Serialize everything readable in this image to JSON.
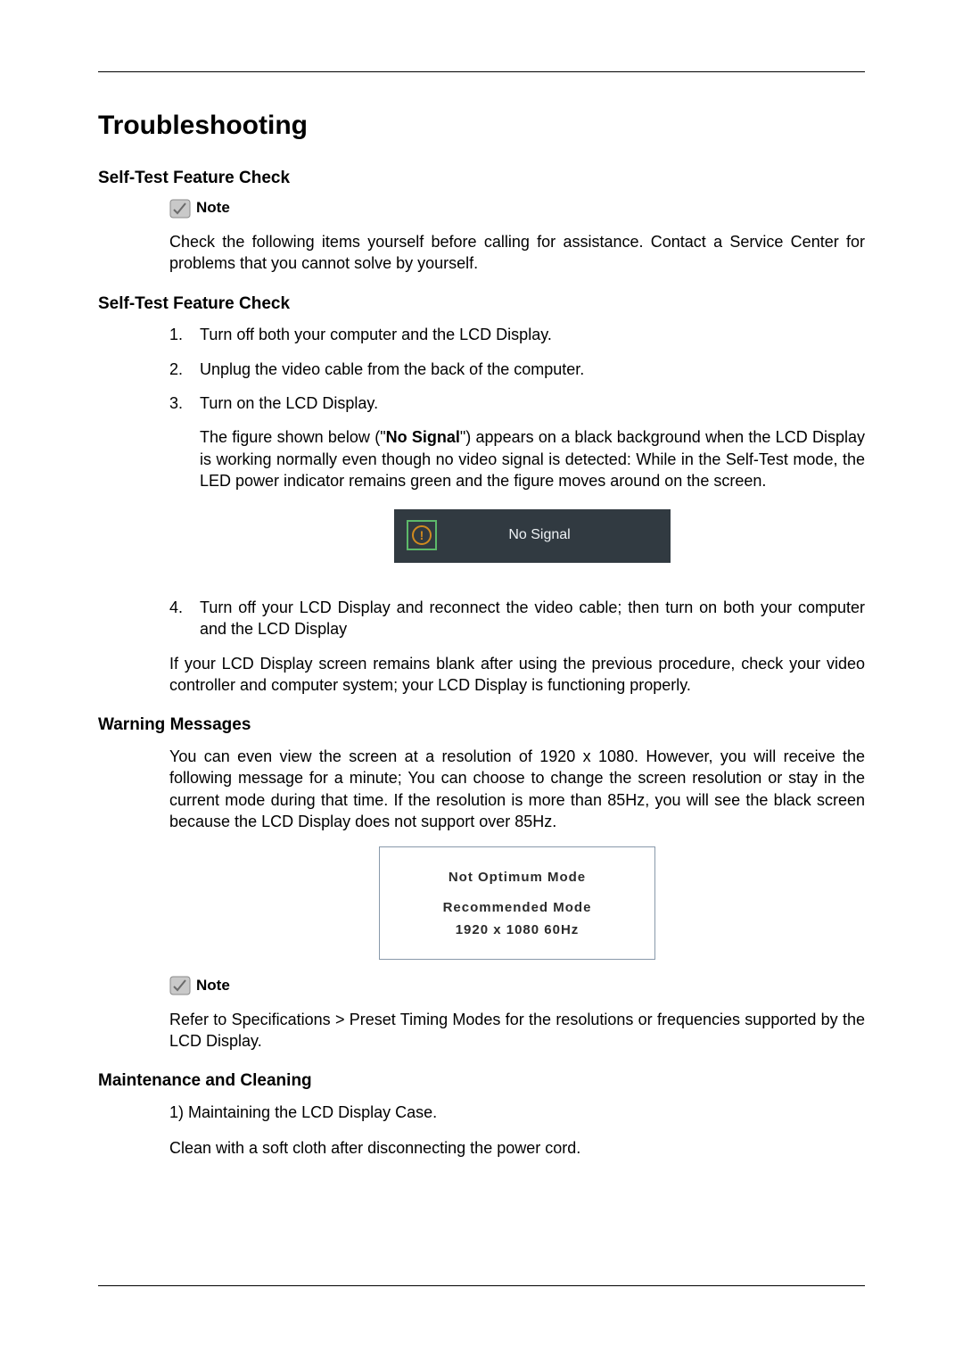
{
  "title": "Troubleshooting",
  "note_label": "Note",
  "sec1": {
    "heading": "Self-Test Feature Check",
    "note_text": "Check the following items yourself before calling for assistance. Contact a Service Center for problems that you cannot solve by yourself."
  },
  "sec2": {
    "heading": "Self-Test Feature Check",
    "steps": {
      "s1": {
        "num": "1.",
        "text": "Turn off both your computer and the LCD Display."
      },
      "s2": {
        "num": "2.",
        "text": "Unplug the video cable from the back of the computer."
      },
      "s3": {
        "num": "3.",
        "text": "Turn on the LCD Display.",
        "extra_a": "The figure shown below (\"",
        "extra_bold": "No Signal",
        "extra_b": "\") appears on a black background when the LCD Display is working normally even though no video signal is detected: While in the Self-Test mode, the LED power indicator remains green and the figure moves around on the screen."
      },
      "s4": {
        "num": "4.",
        "text": "Turn off your LCD Display and reconnect the video cable; then turn on both your computer and the LCD Display"
      }
    },
    "figure_no_signal": {
      "warn_glyph": "!",
      "text": "No Signal"
    },
    "after": "If your LCD Display screen remains blank after using the previous procedure, check your video controller and computer system; your LCD Display is functioning properly."
  },
  "sec3": {
    "heading": "Warning Messages",
    "para": "You can even view the screen at a resolution of 1920 x 1080. However, you will receive the following message for a minute; You can choose to change the screen resolution or stay in the current mode during that time. If the resolution is more than 85Hz, you will see the black screen because the LCD Display does not support over 85Hz.",
    "figure": {
      "line1": "Not Optimum Mode",
      "line2": "Recommended Mode",
      "line3": "1920 x 1080  60Hz"
    },
    "note_text": "Refer to Specifications > Preset Timing Modes for the resolutions or frequencies supported by the LCD Display."
  },
  "sec4": {
    "heading": "Maintenance and Cleaning",
    "p1": "1) Maintaining the LCD Display Case.",
    "p2": "Clean with a soft cloth after disconnecting the power cord."
  }
}
